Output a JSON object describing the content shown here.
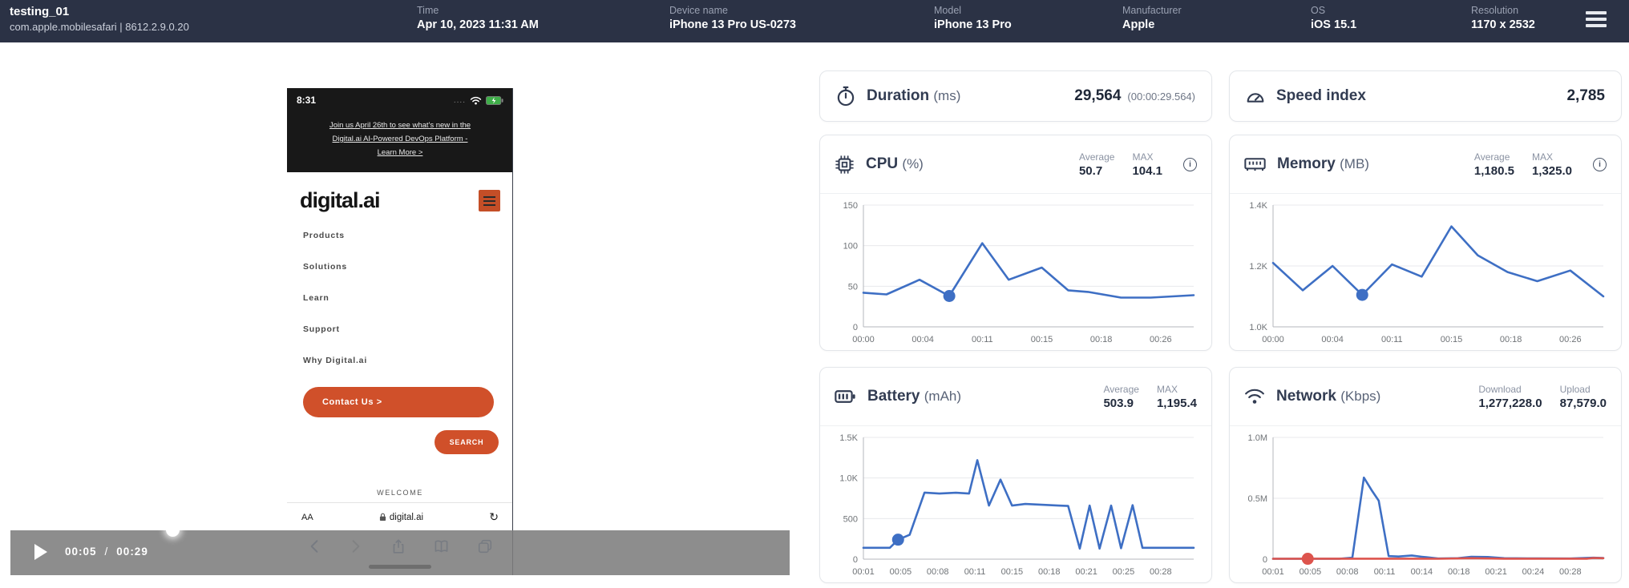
{
  "header": {
    "test_name": "testing_01",
    "app_id": "com.apple.mobilesafari | 8612.2.9.0.20",
    "fields": [
      {
        "label": "Time",
        "value": "Apr 10, 2023 11:31 AM"
      },
      {
        "label": "Device name",
        "value": "iPhone 13 Pro US-0273"
      },
      {
        "label": "Model",
        "value": "iPhone 13 Pro"
      },
      {
        "label": "Manufacturer",
        "value": "Apple"
      },
      {
        "label": "OS",
        "value": "iOS 15.1"
      },
      {
        "label": "Resolution",
        "value": "1170 x 2532"
      }
    ]
  },
  "player": {
    "current_time": "00:05",
    "separator": "/",
    "duration": "00:29"
  },
  "phone": {
    "status_time": "8:31",
    "cell_dots": "....",
    "banner_lines": [
      "Join us April 26th to see what's new in the",
      "Digital.ai AI-Powered DevOps Platform -",
      "Learn More >"
    ],
    "logo": "digital.ai",
    "menu_items": [
      "Products",
      "Solutions",
      "Learn",
      "Support",
      "Why Digital.ai"
    ],
    "contact_button": "Contact Us >",
    "search_button": "SEARCH",
    "welcome": "WELCOME",
    "url_zoom": "AA",
    "url": "digital.ai"
  },
  "cards": {
    "duration": {
      "title": "Duration",
      "unit": "(ms)",
      "value": "29,564",
      "subvalue": "(00:00:29.564)"
    },
    "speed": {
      "title": "Speed index",
      "value": "2,785"
    },
    "cpu": {
      "title": "CPU",
      "unit": "(%)",
      "stat1_label": "Average",
      "stat1": "50.7",
      "stat2_label": "MAX",
      "stat2": "104.1"
    },
    "memory": {
      "title": "Memory",
      "unit": "(MB)",
      "stat1_label": "Average",
      "stat1": "1,180.5",
      "stat2_label": "MAX",
      "stat2": "1,325.0"
    },
    "battery": {
      "title": "Battery",
      "unit": "(mAh)",
      "stat1_label": "Average",
      "stat1": "503.9",
      "stat2_label": "MAX",
      "stat2": "1,195.4"
    },
    "network": {
      "title": "Network",
      "unit": "(Kbps)",
      "stat1_label": "Download",
      "stat1": "1,277,228.0",
      "stat2_label": "Upload",
      "stat2": "87,579.0"
    }
  },
  "colors": {
    "header_bg": "#2b3245",
    "accent_blue": "#3e6fc4",
    "accent_red": "#dd544d",
    "orange": "#d0502a"
  },
  "chart_data": [
    {
      "id": "cpu",
      "type": "line",
      "title": "CPU (%)",
      "ylim": [
        0,
        150
      ],
      "yticks": [
        {
          "value": 0,
          "label": "0"
        },
        {
          "value": 50,
          "label": "50"
        },
        {
          "value": 100,
          "label": "100"
        },
        {
          "value": 150,
          "label": "150"
        }
      ],
      "xticks": [
        "00:00",
        "00:04",
        "00:11",
        "00:15",
        "00:18",
        "00:26"
      ],
      "series": [
        {
          "name": "CPU",
          "color": "#3e6fc4",
          "points": [
            [
              0,
              42
            ],
            [
              0.07,
              40
            ],
            [
              0.17,
              58
            ],
            [
              0.26,
              38
            ],
            [
              0.36,
              103
            ],
            [
              0.44,
              58
            ],
            [
              0.54,
              73
            ],
            [
              0.62,
              45
            ],
            [
              0.68,
              43
            ],
            [
              0.78,
              36
            ],
            [
              0.87,
              36
            ],
            [
              1,
              39
            ]
          ]
        }
      ],
      "markers": [
        {
          "x": 0.26,
          "y": 38,
          "color": "#3e6fc4"
        }
      ],
      "average": 50.7,
      "max": 104.1
    },
    {
      "id": "memory",
      "type": "line",
      "title": "Memory (MB)",
      "ylim": [
        1000,
        1400
      ],
      "yticks": [
        {
          "value": 1000,
          "label": "1.0K"
        },
        {
          "value": 1200,
          "label": "1.2K"
        },
        {
          "value": 1400,
          "label": "1.4K"
        }
      ],
      "xticks": [
        "00:00",
        "00:04",
        "00:11",
        "00:15",
        "00:18",
        "00:26"
      ],
      "series": [
        {
          "name": "Memory",
          "color": "#3e6fc4",
          "points": [
            [
              0,
              1210
            ],
            [
              0.09,
              1120
            ],
            [
              0.18,
              1200
            ],
            [
              0.27,
              1105
            ],
            [
              0.36,
              1205
            ],
            [
              0.45,
              1165
            ],
            [
              0.54,
              1330
            ],
            [
              0.62,
              1235
            ],
            [
              0.71,
              1180
            ],
            [
              0.8,
              1150
            ],
            [
              0.9,
              1185
            ],
            [
              1,
              1100
            ]
          ]
        }
      ],
      "markers": [
        {
          "x": 0.27,
          "y": 1105,
          "color": "#3e6fc4"
        }
      ],
      "average": 1180.5,
      "max": 1325.0
    },
    {
      "id": "battery",
      "type": "line",
      "title": "Battery (mAh)",
      "ylim": [
        0,
        1500
      ],
      "yticks": [
        {
          "value": 0,
          "label": "0"
        },
        {
          "value": 500,
          "label": "500"
        },
        {
          "value": 1000,
          "label": "1.0K"
        },
        {
          "value": 1500,
          "label": "1.5K"
        }
      ],
      "xticks": [
        "00:01",
        "00:05",
        "00:08",
        "00:11",
        "00:15",
        "00:18",
        "00:21",
        "00:25",
        "00:28"
      ],
      "series": [
        {
          "name": "Battery",
          "color": "#3e6fc4",
          "points": [
            [
              0,
              140
            ],
            [
              0.08,
              140
            ],
            [
              0.105,
              240
            ],
            [
              0.14,
              300
            ],
            [
              0.185,
              820
            ],
            [
              0.23,
              808
            ],
            [
              0.28,
              818
            ],
            [
              0.32,
              808
            ],
            [
              0.345,
              1220
            ],
            [
              0.38,
              660
            ],
            [
              0.415,
              980
            ],
            [
              0.45,
              660
            ],
            [
              0.49,
              680
            ],
            [
              0.54,
              670
            ],
            [
              0.59,
              660
            ],
            [
              0.62,
              655
            ],
            [
              0.655,
              130
            ],
            [
              0.685,
              660
            ],
            [
              0.715,
              130
            ],
            [
              0.75,
              660
            ],
            [
              0.78,
              135
            ],
            [
              0.815,
              665
            ],
            [
              0.845,
              140
            ],
            [
              0.9,
              140
            ],
            [
              1,
              140
            ]
          ]
        }
      ],
      "markers": [
        {
          "x": 0.105,
          "y": 240,
          "color": "#3e6fc4"
        }
      ],
      "average": 503.9,
      "max": 1195.4
    },
    {
      "id": "network",
      "type": "line",
      "title": "Network (Kbps)",
      "ylim": [
        0,
        1000000
      ],
      "yticks": [
        {
          "value": 0,
          "label": "0"
        },
        {
          "value": 500000,
          "label": "0.5M"
        },
        {
          "value": 1000000,
          "label": "1.0M"
        }
      ],
      "xticks": [
        "00:01",
        "00:05",
        "00:08",
        "00:11",
        "00:14",
        "00:18",
        "00:21",
        "00:24",
        "00:28"
      ],
      "series": [
        {
          "name": "Download",
          "color": "#3e6fc4",
          "points": [
            [
              0,
              3000
            ],
            [
              0.2,
              3000
            ],
            [
              0.24,
              12000
            ],
            [
              0.275,
              670000
            ],
            [
              0.3,
              560000
            ],
            [
              0.32,
              480000
            ],
            [
              0.35,
              25000
            ],
            [
              0.38,
              22000
            ],
            [
              0.42,
              30000
            ],
            [
              0.45,
              20000
            ],
            [
              0.5,
              5000
            ],
            [
              0.56,
              8000
            ],
            [
              0.6,
              20000
            ],
            [
              0.65,
              18000
            ],
            [
              0.7,
              8000
            ],
            [
              0.8,
              6000
            ],
            [
              0.9,
              5000
            ],
            [
              0.97,
              12000
            ],
            [
              1,
              10000
            ]
          ]
        },
        {
          "name": "Upload",
          "color": "#dd544d",
          "points": [
            [
              0,
              3000
            ],
            [
              0.3,
              4000
            ],
            [
              0.5,
              3000
            ],
            [
              0.6,
              8000
            ],
            [
              0.7,
              4000
            ],
            [
              0.95,
              4000
            ],
            [
              0.97,
              10000
            ],
            [
              1,
              8000
            ]
          ]
        }
      ],
      "markers": [
        {
          "x": 0.105,
          "y": 3000,
          "color": "#dd544d"
        }
      ],
      "download": 1277228.0,
      "upload": 87579.0
    }
  ]
}
